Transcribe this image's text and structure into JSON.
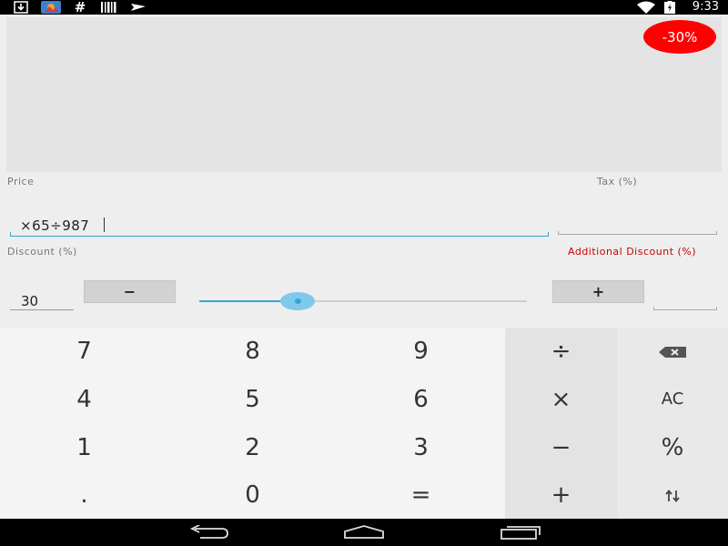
{
  "status_bar": {
    "time": "9:33",
    "left_icons": [
      "download-icon",
      "photo-icon",
      "hash-icon",
      "barcode-icon",
      "send-icon"
    ],
    "right_icons": [
      "wifi-icon",
      "battery-charging-icon"
    ]
  },
  "display": {
    "discount_badge": "-30%"
  },
  "labels": {
    "price": "Price",
    "tax": "Tax (%)",
    "discount": "Discount (%)",
    "additional_discount": "Additional Discount (%)"
  },
  "inputs": {
    "price_value": "×65÷987",
    "tax_value": "",
    "discount_value": "30",
    "additional_discount_value": ""
  },
  "stepper": {
    "minus_label": "−",
    "plus_label": "+",
    "slider_level": 0.3
  },
  "keypad": {
    "rows": [
      [
        "7",
        "8",
        "9",
        "÷",
        "⌫"
      ],
      [
        "4",
        "5",
        "6",
        "×",
        "AC"
      ],
      [
        "1",
        "2",
        "3",
        "−",
        "%"
      ],
      [
        ".",
        "0",
        "=",
        "+",
        "⇅"
      ]
    ]
  },
  "colors": {
    "accent": "#33a6d6",
    "badge": "#ff0000",
    "additional_discount_label": "#cc0000"
  },
  "nav_bar": {
    "icons": [
      "back-icon",
      "home-icon",
      "recents-icon"
    ]
  }
}
